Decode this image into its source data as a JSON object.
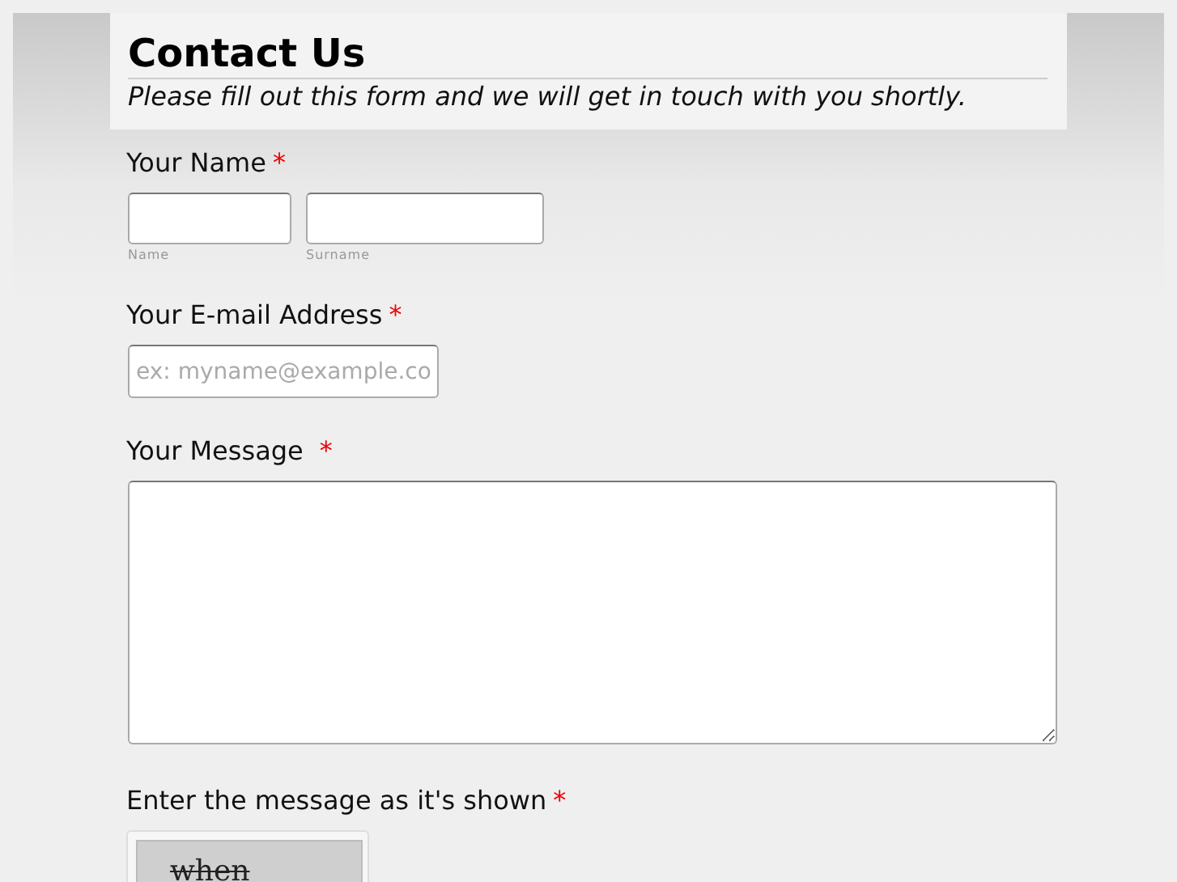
{
  "header": {
    "title": "Contact Us",
    "subtitle": "Please fill out this form and we will get in touch with you shortly."
  },
  "fields": [
    {
      "kind": "name",
      "label": "Your Name",
      "required": "*",
      "parts": [
        {
          "sublabel": "Name"
        },
        {
          "sublabel": "Surname"
        }
      ]
    },
    {
      "kind": "email",
      "label": "Your E-mail Address",
      "required": "*",
      "placeholder": "ex: myname@example.co"
    },
    {
      "kind": "message",
      "label": "Your Message",
      "required": "*"
    },
    {
      "kind": "captcha",
      "label": "Enter the message as it's shown",
      "required": "*",
      "captcha_text": "when"
    }
  ]
}
